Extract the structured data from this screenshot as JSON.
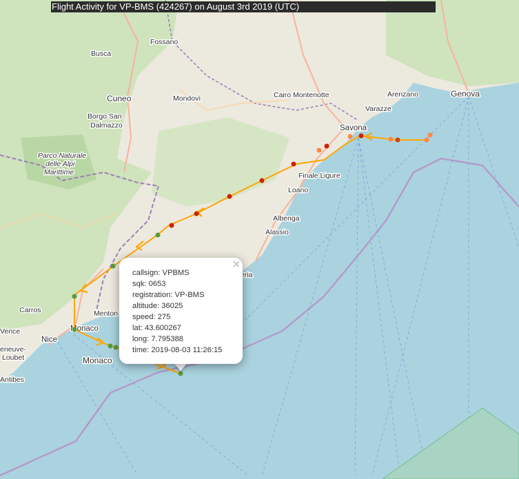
{
  "title": "Flight Activity for VP-BMS (424267) on August 3rd 2019 (UTC)",
  "place_labels": {
    "fossano": "Fossano",
    "busca": "Busca",
    "cuneo": "Cuneo",
    "mondovi": "Mondovì",
    "borgo_san_dalmazzo_1": "Borgo San",
    "borgo_san_dalmazzo_2": "Dalmazzo",
    "cairo_montenotte": "Cairo Montenotte",
    "arenzano": "Arenzano",
    "genova": "Genova",
    "varazze": "Varazze",
    "savona": "Savona",
    "park_1": "Parco Naturale",
    "park_2": "delle Alpi",
    "park_3": "Marittime",
    "finale_ligure": "Finale Ligure",
    "loano": "Loano",
    "albenga": "Albenga",
    "alassio": "Alassio",
    "imperia_partial": "eria",
    "menton": "Menton",
    "monaco_city": "Monaco",
    "monaco_country": "Monaco",
    "nice": "Nice",
    "carros": "Carros",
    "vence": "Vence",
    "villeneuve_loubet_1": "eneuve-",
    "villeneuve_loubet_2": "Loubet",
    "antibes": "Antibes"
  },
  "popup": {
    "close_icon": "×",
    "callsign": "callsign: VPBMS",
    "sqk": "sqk: 0653",
    "registration": "registration: VP-BMS",
    "altitude": "altitude: 36025",
    "speed": "speed: 275",
    "lat": "lat: 43.600267",
    "long": "long: 7.795388",
    "time": "time: 2019-08-03 11:26:15"
  },
  "colors": {
    "sea": "#aad3df",
    "land": "#f2efe9",
    "forest": "#add19e",
    "track": "#ffa500",
    "point_red": "#cc2200",
    "point_green": "#5a9a3a",
    "point_orange": "#ff8844",
    "border": "#9e7fb4"
  }
}
